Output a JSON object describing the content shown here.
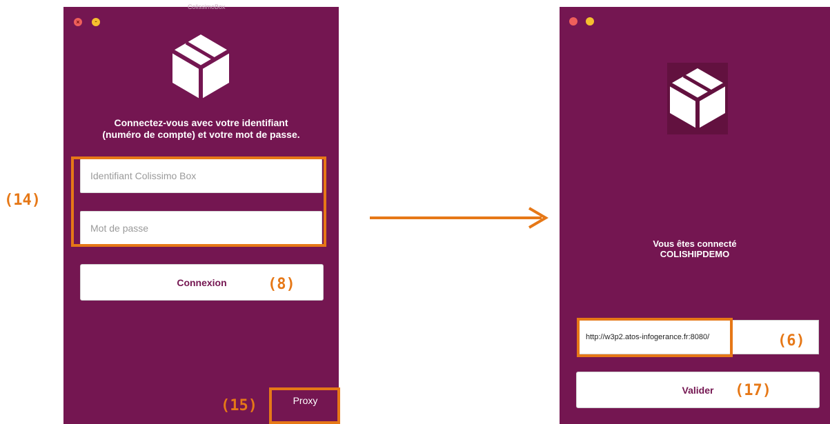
{
  "login_window": {
    "title": "ColissimoBox",
    "heading_line1": "Connectez-vous avec votre identifiant",
    "heading_line2": "(numéro de compte) et votre mot de passe.",
    "username_placeholder": "Identifiant Colissimo Box",
    "password_placeholder": "Mot de passe",
    "connect_label": "Connexion",
    "proxy_label": "Proxy",
    "close_glyph": "×",
    "minimize_glyph": "-"
  },
  "connected_window": {
    "line1": "Vous êtes connecté",
    "line2": "COLISHIPDEMO",
    "url_value": "http://w3p2.atos-infogerance.fr:8080/",
    "validate_label": "Valider"
  },
  "callouts": {
    "fields": "(14)",
    "connect": "(8)",
    "proxy": "(15)",
    "url": "(6)",
    "validate": "(17)"
  },
  "colors": {
    "panel": "#741651",
    "accent": "#e67817",
    "close_dot": "#ee5f5b",
    "minimize_dot": "#f5bf2f"
  }
}
